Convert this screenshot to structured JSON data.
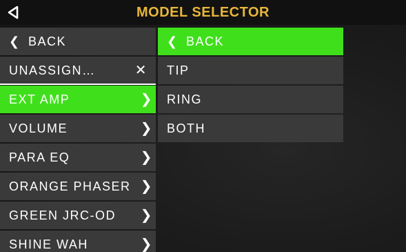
{
  "header": {
    "title": "MODEL SELECTOR",
    "back_icon": "triangle-left-icon"
  },
  "colors": {
    "accent_title": "#e7b73b",
    "selected": "#3fe01b",
    "item_bg": "#3a3a3a",
    "header_bg": "#111111"
  },
  "left_menu": {
    "items": [
      {
        "label": "BACK",
        "icon": "chevron-left-icon"
      },
      {
        "label": "UNASSIGN…",
        "icon": "close-icon"
      },
      {
        "label": "EXT AMP",
        "icon": "chevron-right-icon",
        "selected": true
      },
      {
        "label": "VOLUME",
        "icon": "chevron-right-icon"
      },
      {
        "label": "PARA EQ",
        "icon": "chevron-right-icon"
      },
      {
        "label": "ORANGE PHASER",
        "icon": "chevron-right-icon"
      },
      {
        "label": "GREEN JRC-OD",
        "icon": "chevron-right-icon"
      },
      {
        "label": "SHINE WAH",
        "icon": "chevron-right-icon"
      }
    ]
  },
  "right_menu": {
    "items": [
      {
        "label": "BACK",
        "icon": "chevron-left-icon",
        "selected": true
      },
      {
        "label": "TIP"
      },
      {
        "label": "RING"
      },
      {
        "label": "BOTH"
      }
    ]
  }
}
